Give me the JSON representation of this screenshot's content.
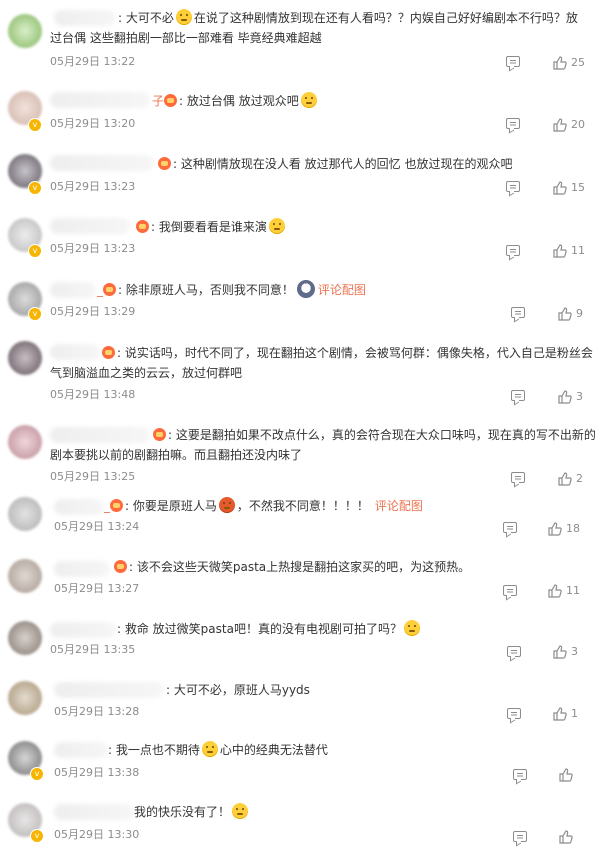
{
  "comments": [
    {
      "segments": [
        ": 大可不必",
        "在说了这种剧情放到现在还有人看吗？？内娱自己好好编剧本不行吗？放",
        "过台偶 这些翻拍剧一部比一部难看 毕竟经典难超越"
      ],
      "time": "05月29日 13:22",
      "likes": "25"
    },
    {
      "name_tail": "子",
      "text": ": 放过台偶 放过观众吧",
      "time": "05月29日 13:20",
      "likes": "20"
    },
    {
      "text": ": 这种剧情放现在没人看 放过那代人的回忆 也放过现在的观众吧",
      "time": "05月29日 13:23",
      "likes": "15"
    },
    {
      "text": ": 我倒要看看是谁来演",
      "time": "05月29日 13:23",
      "likes": "11"
    },
    {
      "name_tail": "_",
      "text": ": 除非原班人马，否则我不同意！",
      "pic_link": "评论配图",
      "time": "05月29日 13:29",
      "likes": "9"
    },
    {
      "lines": [
        ": 说实话吗，时代不同了，现在翻拍这个剧情，会被骂何群：偶像失格，代入自己是粉丝会",
        "气到脑溢血之类的云云，放过何群吧"
      ],
      "time": "05月29日 13:48",
      "likes": "3"
    },
    {
      "lines": [
        ": 这要是翻拍如果不改点什么，真的会符合现在大众口味吗，现在真的写不出新的",
        "剧本要挑以前的剧翻拍嘛。而且翻拍还没内味了"
      ],
      "time": "05月29日 13:25",
      "likes": "2"
    },
    {
      "name_tail": "_",
      "text_a": ": 你要是原班人马",
      "text_b": "，不然我不同意！！！！",
      "pic_link": "评论配图",
      "time": "05月29日 13:24",
      "likes": "18"
    },
    {
      "text": ": 该不会这些天微笑pasta上热搜是翻拍这家买的吧，为这预热。",
      "time": "05月29日 13:27",
      "likes": "11"
    },
    {
      "text": ": 救命 放过微笑pasta吧！真的没有电视剧可拍了吗？",
      "time": "05月29日 13:35",
      "likes": "3"
    },
    {
      "text": ": 大可不必，原班人马yyds",
      "time": "05月29日 13:28",
      "likes": "1"
    },
    {
      "text_a": ": 我一点也不期待",
      "text_b": "心中的经典无法替代",
      "time": "05月29日 13:38",
      "likes": ""
    },
    {
      "text": "我的快乐没有了！",
      "time": "05月29日 13:30",
      "likes": ""
    }
  ]
}
